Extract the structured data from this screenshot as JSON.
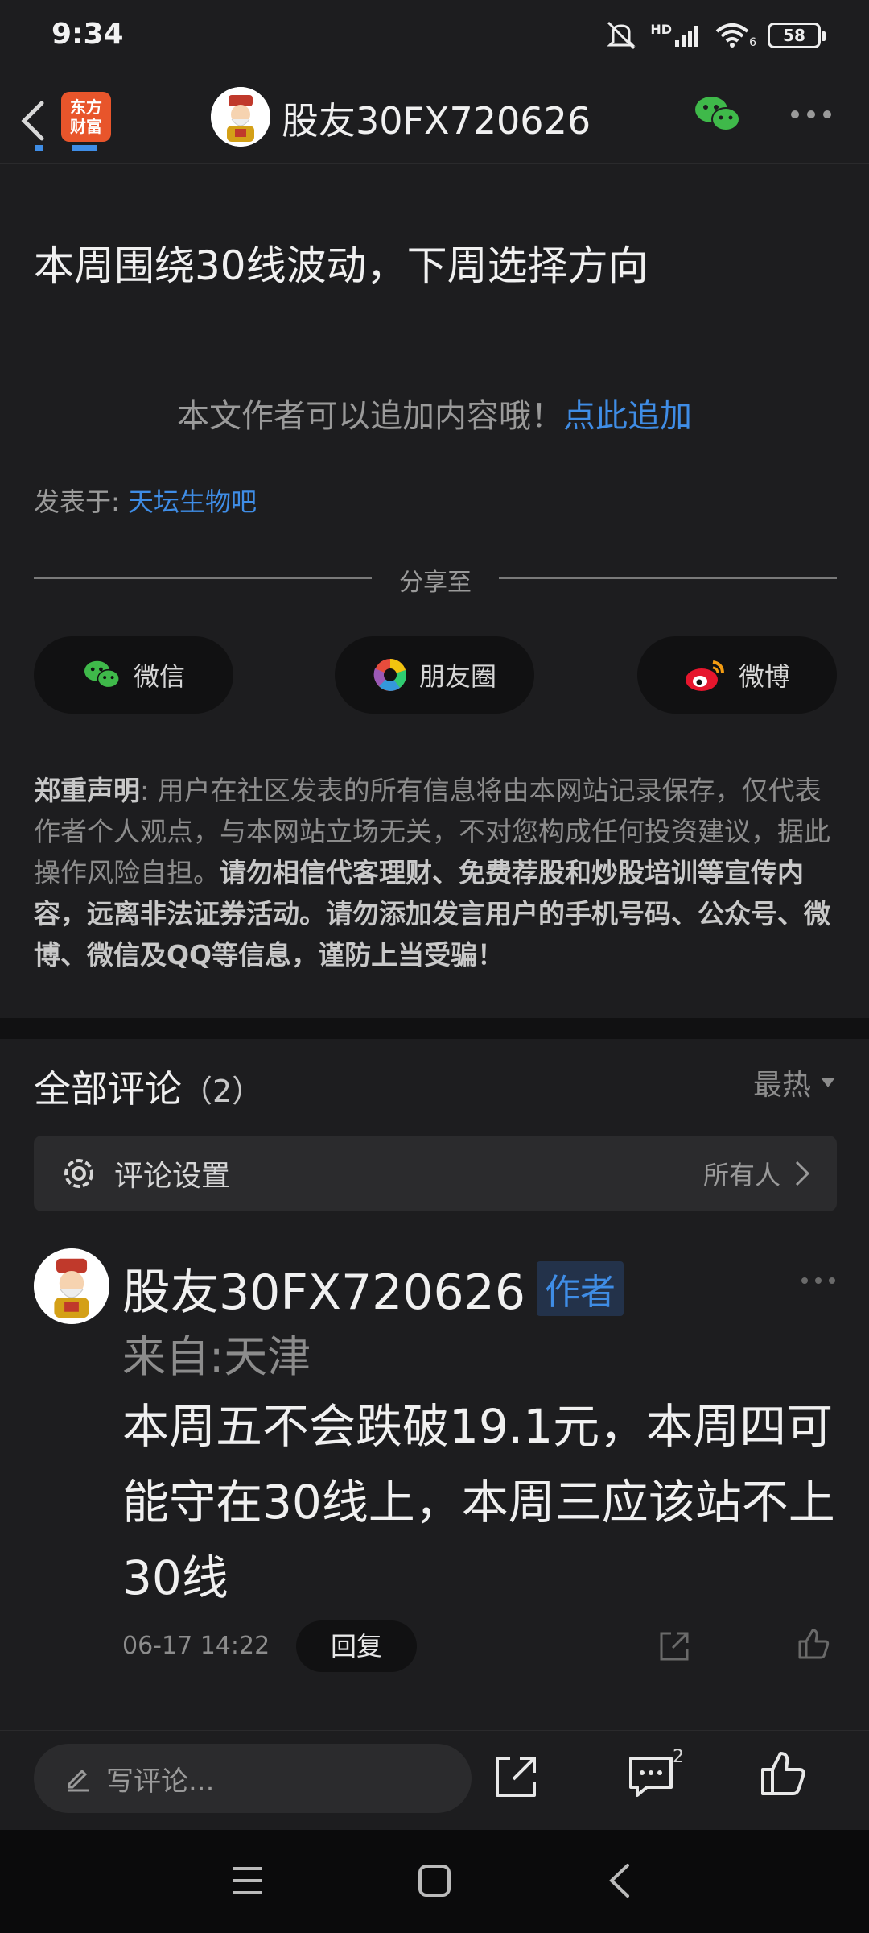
{
  "status": {
    "time": "9:34",
    "network": "HD",
    "signal_sub": "6",
    "battery": "58"
  },
  "header": {
    "logo_line1": "东方",
    "logo_line2": "财富",
    "title": "股友30FX720626"
  },
  "article": {
    "title": "本周围绕30线波动，下周选择方向",
    "append_text": "本文作者可以追加内容哦！",
    "append_link": "点此追加",
    "posted_in_label": "发表于:",
    "posted_in_bar": "天坛生物吧"
  },
  "share": {
    "label": "分享至",
    "wechat": "微信",
    "moments": "朋友圈",
    "weibo": "微博"
  },
  "disclaimer": {
    "heading": "郑重声明",
    "normal": ": 用户在社区发表的所有信息将由本网站记录保存，仅代表作者个人观点，与本网站立场无关，不对您构成任何投资建议，据此操作风险自担。",
    "bold": "请勿相信代客理财、免费荐股和炒股培训等宣传内容，远离非法证券活动。请勿添加发言用户的手机号码、公众号、微博、微信及QQ等信息，谨防上当受骗！"
  },
  "comments": {
    "heading": "全部评论",
    "count": "（2）",
    "sort": "最热",
    "settings_label": "评论设置",
    "settings_value": "所有人",
    "items": [
      {
        "user": "股友30FX720626",
        "tag": "作者",
        "location": "来自:天津",
        "text": "本周五不会跌破19.1元，本周四可能守在30线上，本周三应该站不上30线",
        "time": "06-17 14:22",
        "reply": "回复"
      }
    ]
  },
  "bottom": {
    "write_placeholder": "写评论...",
    "comment_badge": "2"
  },
  "colors": {
    "link": "#3f8de6",
    "background": "#1d1d1f",
    "wechat_green": "#3fb94a",
    "logo_orange": "#e8552b"
  }
}
